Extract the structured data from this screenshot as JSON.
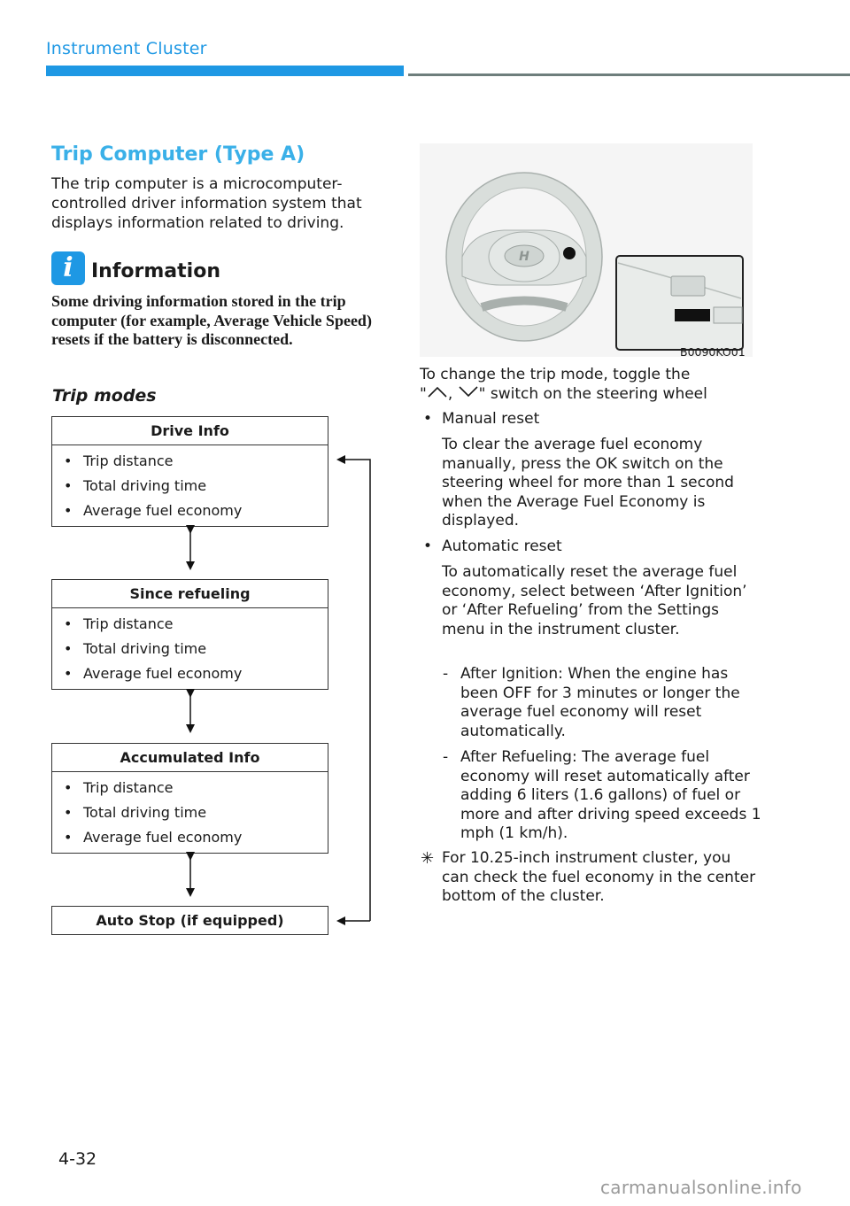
{
  "header": {
    "section_title": "Instrument Cluster",
    "accent_color": "#1e98e4"
  },
  "main": {
    "heading": "Trip Computer (Type A)",
    "intro": "The trip computer is a microcomputer-controlled driver information system that displays information related to driving.",
    "info": {
      "icon": "info-icon",
      "title": "Information",
      "text": "Some driving information stored in the trip computer (for example, Average Vehicle Speed) resets if the battery is disconnected."
    },
    "trip_modes_heading": "Trip modes",
    "trip_modes": [
      {
        "title": "Drive Info",
        "items": [
          "Trip distance",
          "Total driving time",
          "Average fuel economy"
        ]
      },
      {
        "title": "Since refueling",
        "items": [
          "Trip distance",
          "Total driving time",
          "Average fuel economy"
        ]
      },
      {
        "title": "Accumulated Info",
        "items": [
          "Trip distance",
          "Total driving time",
          "Average fuel economy"
        ]
      },
      {
        "title": "Auto Stop (if equipped)",
        "items": []
      }
    ],
    "bullet_char": "•"
  },
  "figure": {
    "code": "B0090KO01",
    "description": "steering-wheel-illustration"
  },
  "right": {
    "toggle_line1": "To change the trip mode, toggle the",
    "toggle_line2_prefix": "\"",
    "toggle_up_icon": "chevron-up-icon",
    "toggle_sep": ",",
    "toggle_down_icon": "chevron-down-icon",
    "toggle_line2_suffix": "\" switch on the steering wheel",
    "manual_reset": {
      "label": "Manual reset",
      "text": "To clear the average fuel economy manually, press the OK switch on the steering wheel for more than 1 second when the Average Fuel Economy is displayed."
    },
    "automatic_reset": {
      "label": "Automatic reset",
      "text": "To automatically reset the average fuel economy, select between ‘After Ignition’ or ‘After Refueling’ from the Settings menu in the instrument cluster.",
      "options": [
        {
          "dash": "-",
          "text": "After Ignition: When the engine has been OFF for 3 minutes or longer the average fuel economy will reset automatically."
        },
        {
          "dash": "-",
          "text": "After Refueling: The average fuel economy will reset automatically after adding 6 liters (1.6 gallons) of fuel or more and after driving speed exceeds 1 mph (1 km/h)."
        }
      ]
    },
    "note_symbol": "✳",
    "note": "For 10.25-inch instrument cluster, you can check the fuel economy in the center bottom of the cluster."
  },
  "footer": {
    "page_number": "4-32",
    "watermark": "carmanualsonline.info"
  }
}
